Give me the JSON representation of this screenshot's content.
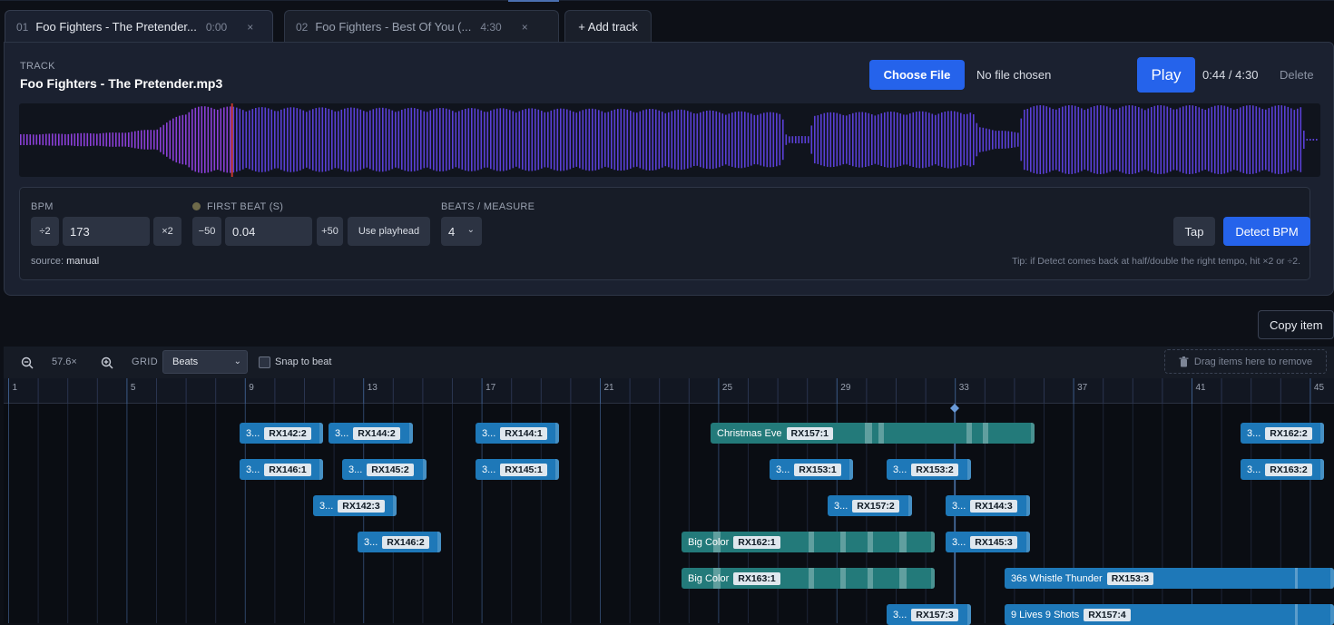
{
  "tabs": [
    {
      "num": "01",
      "title": "Foo Fighters - The Pretender...",
      "time": "0:00",
      "close": "×"
    },
    {
      "num": "02",
      "title": "Foo Fighters - Best Of You (...",
      "time": "4:30",
      "close": "×"
    }
  ],
  "add_track": "+ Add track",
  "track": {
    "label": "TRACK",
    "name": "Foo Fighters - The Pretender.mp3",
    "choose_file": "Choose File",
    "no_file": "No file chosen",
    "play": "Play",
    "time": "0:44 / 4:30",
    "delete": "Delete",
    "playhead_fraction": 0.163
  },
  "tempo": {
    "bpm_label": "BPM",
    "half": "÷2",
    "bpm": "173",
    "double": "×2",
    "first_beat_label": "FIRST BEAT (S)",
    "minus50": "−50",
    "first_beat": "0.04",
    "plus50": "+50",
    "use_playhead": "Use playhead",
    "beats_label": "BEATS / MEASURE",
    "beats": "4",
    "source_prefix": "source:",
    "source": "manual",
    "tap": "Tap",
    "detect": "Detect BPM",
    "tip": "Tip: if Detect comes back at half/double the right tempo, hit ×2 or ÷2."
  },
  "copy_item": "Copy item",
  "timeline": {
    "zoom_out_icon": "zoom-out-icon",
    "zoom": "57.6×",
    "zoom_in_icon": "zoom-in-icon",
    "grid_label": "GRID",
    "grid": "Beats",
    "snap": "Snap to beat",
    "drop": "Drag items here to remove",
    "trash_icon": "trash-icon",
    "measures": [
      "1",
      "5",
      "9",
      "13",
      "17",
      "21",
      "25",
      "29",
      "33",
      "37",
      "41",
      "45"
    ]
  },
  "clips": [
    {
      "name": "3...",
      "tag": "RX142:2",
      "color": "blue"
    },
    {
      "name": "3...",
      "tag": "RX144:2",
      "color": "blue"
    },
    {
      "name": "3...",
      "tag": "RX144:1",
      "color": "blue"
    },
    {
      "name": "Christmas Eve",
      "tag": "RX157:1",
      "color": "teal"
    },
    {
      "name": "3...",
      "tag": "RX162:2",
      "color": "blue"
    },
    {
      "name": "3...",
      "tag": "RX146:1",
      "color": "blue"
    },
    {
      "name": "3...",
      "tag": "RX145:2",
      "color": "blue"
    },
    {
      "name": "3...",
      "tag": "RX145:1",
      "color": "blue"
    },
    {
      "name": "3...",
      "tag": "RX153:1",
      "color": "blue"
    },
    {
      "name": "3...",
      "tag": "RX153:2",
      "color": "blue"
    },
    {
      "name": "3...",
      "tag": "RX163:2",
      "color": "blue"
    },
    {
      "name": "3...",
      "tag": "RX142:3",
      "color": "blue"
    },
    {
      "name": "3...",
      "tag": "RX157:2",
      "color": "blue"
    },
    {
      "name": "3...",
      "tag": "RX144:3",
      "color": "blue"
    },
    {
      "name": "3...",
      "tag": "RX146:2",
      "color": "blue"
    },
    {
      "name": "Big Color",
      "tag": "RX162:1",
      "color": "teal"
    },
    {
      "name": "3...",
      "tag": "RX145:3",
      "color": "blue"
    },
    {
      "name": "Big Color",
      "tag": "RX163:1",
      "color": "teal"
    },
    {
      "name": "36s Whistle Thunder",
      "tag": "RX153:3",
      "color": "blue"
    },
    {
      "name": "3...",
      "tag": "RX157:3",
      "color": "blue"
    },
    {
      "name": "9 Lives 9 Shots",
      "tag": "RX157:4",
      "color": "blue"
    }
  ]
}
